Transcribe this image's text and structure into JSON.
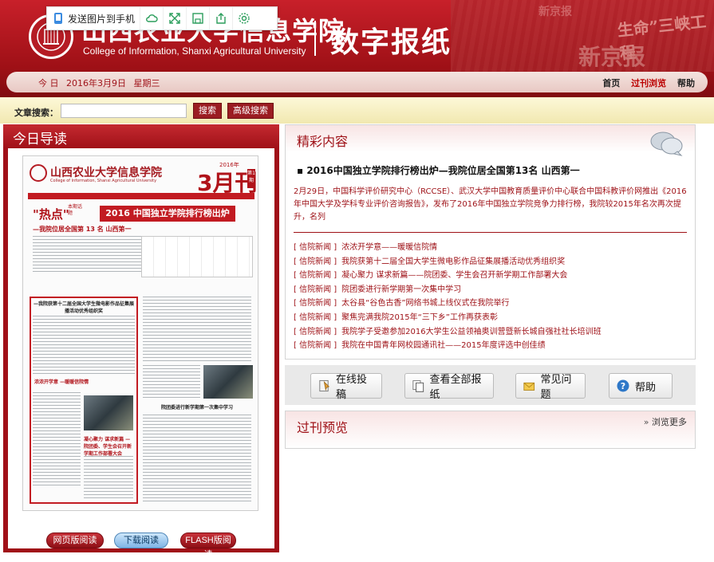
{
  "header": {
    "school_name_cn": "山西农业大学信息学院",
    "school_name_en": "College of Information, Shanxi Agricultural University",
    "title": "数字报纸"
  },
  "nav": {
    "date_label": "今 日",
    "date": "2016年3月9日",
    "weekday": "星期三",
    "links": [
      {
        "label": "首页",
        "active": false
      },
      {
        "label": "过刊浏览",
        "active": true
      },
      {
        "label": "帮助",
        "active": false
      }
    ]
  },
  "search": {
    "label": "文章搜索：",
    "value": "",
    "search_label": "搜索",
    "advanced_label": "高级搜索"
  },
  "left_panel": {
    "title": "今日导读",
    "toolbar": {
      "send_label": "发送图片到手机",
      "icons": [
        "phone-icon",
        "cloud-icon",
        "fullscreen-icon",
        "save-icon",
        "share-icon",
        "settings-icon"
      ]
    },
    "newspaper": {
      "masthead": "山西农业大学信息学院",
      "masthead_en": "College of Information, Shanxi Agricultural University",
      "month": "3月刊",
      "year": "2016年",
      "issue": "第1期",
      "hot": "\"热点\"",
      "hot_sub": "本期话题",
      "headline": "2016 中国独立学院排行榜出炉",
      "subheadline": "—我院位居全国第 13 名 山西第一",
      "story1_head": "—我院获第十二届全国大学生微电影作品征集展播活动优秀组织奖",
      "story2_head": "浓浓开学意 —暖暖信院情",
      "story3_head": "凝心聚力 谋求新篇 —院团委、学生会召开新学期工作部署大会",
      "story4_head": "院团委进行新学期第一次集中学习"
    },
    "buttons": {
      "web": "网页版阅读",
      "download": "下载阅读",
      "flash": "FLASH版阅读"
    }
  },
  "highlights": {
    "title": "精彩内容",
    "feature_title": "2016中国独立学院排行榜出炉—我院位居全国第13名 山西第一",
    "feature_desc": "2月29日，中国科学评价研究中心（RCCSE）、武汉大学中国教育质量评价中心联合中国科教评价网推出《2016年中国大学及学科专业评价咨询报告》，发布了2016年中国独立学院竞争力排行榜，我院较2015年名次再次提升，名列",
    "news": [
      {
        "category": "[ 信院新闻 ]",
        "title": "浓浓开学意——暖暖信院情"
      },
      {
        "category": "[ 信院新闻 ]",
        "title": "我院获第十二届全国大学生微电影作品征集展播活动优秀组织奖"
      },
      {
        "category": "[ 信院新闻 ]",
        "title": "凝心聚力 谋求新篇——院团委、学生会召开新学期工作部署大会"
      },
      {
        "category": "[ 信院新闻 ]",
        "title": "院团委进行新学期第一次集中学习"
      },
      {
        "category": "[ 信院新闻 ]",
        "title": "太谷县“谷色古香”网络书城上线仪式在我院举行"
      },
      {
        "category": "[ 信院新闻 ]",
        "title": "聚焦完满我院2015年“三下乡”工作再获表彰"
      },
      {
        "category": "[ 信院新闻 ]",
        "title": "我院学子受邀参加2016大学生公益领袖奥训营暨新长城自强社社长培训班"
      },
      {
        "category": "[ 信院新闻 ]",
        "title": "我院在中国青年网校园通讯社——2015年度评选中创佳绩"
      }
    ]
  },
  "actions": {
    "submit": "在线投稿",
    "view_all": "查看全部报纸",
    "faq": "常见问题",
    "help": "帮助"
  },
  "past": {
    "title": "过刊预览",
    "more": "浏览更多"
  },
  "colors": {
    "brand_red": "#9e1016",
    "nav_bg": "#f4e3df",
    "search_bg": "#fdf8d8"
  }
}
